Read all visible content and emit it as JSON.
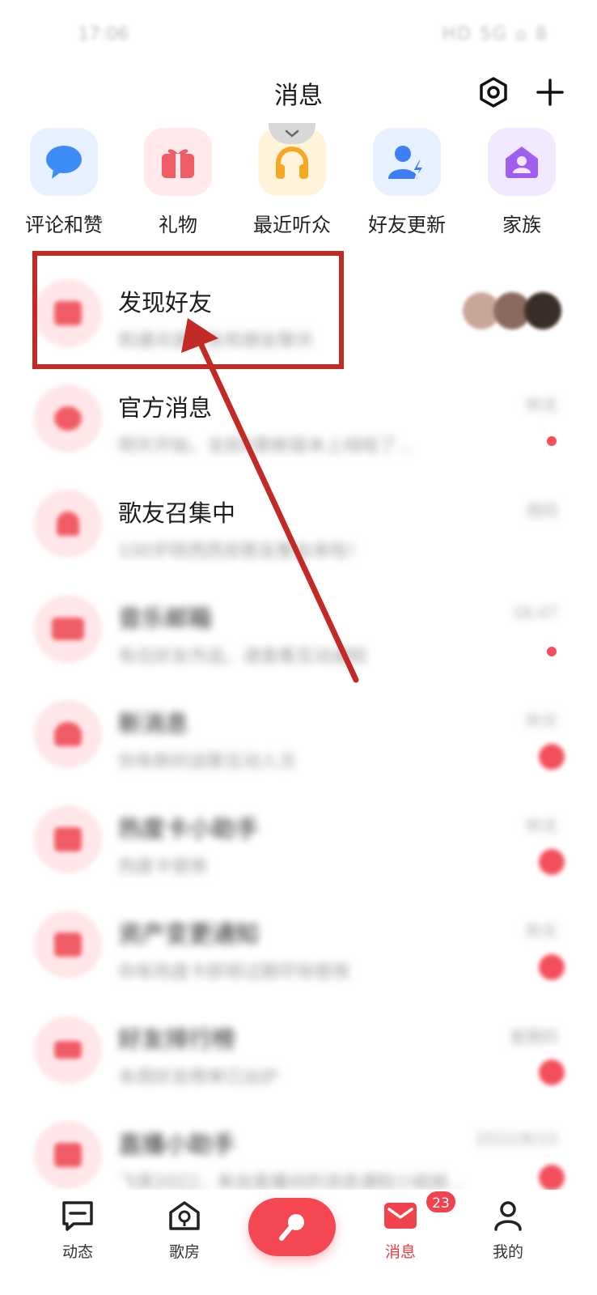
{
  "status_bar": {
    "time": "17:06",
    "icons": "HD 5G ⌂ 8"
  },
  "header": {
    "title": "消息",
    "settings_icon": "hexagon-settings-icon",
    "add_icon": "plus-icon"
  },
  "shortcuts": [
    {
      "label": "评论和赞",
      "icon": "chat-bubble-icon",
      "color": "#3d8cf5"
    },
    {
      "label": "礼物",
      "icon": "gift-icon",
      "color": "#f05c66"
    },
    {
      "label": "最近听众",
      "icon": "headphones-icon",
      "color": "#f7a823"
    },
    {
      "label": "好友更新",
      "icon": "user-lightning-icon",
      "color": "#3d7ef5"
    },
    {
      "label": "家族",
      "icon": "family-house-icon",
      "color": "#9f5ef0"
    }
  ],
  "messages": [
    {
      "title": "发现好友",
      "preview": "和通讯录好友和朋友聊天",
      "time": ""
    },
    {
      "title": "官方消息",
      "preview": "明天开始，全民K歌新版本上线啦了...",
      "time": "昨天"
    },
    {
      "title": "歌友召集中",
      "preview": "100岁陕西西安歌友聚会来啦！",
      "time": "周四"
    },
    {
      "title": "音乐邮箱",
      "preview": "有位好友作品，请查看互动通知",
      "time": "16:47"
    },
    {
      "title": "新消息",
      "preview": "你有新的送歌互动人次",
      "time": "昨天"
    },
    {
      "title": "热度卡小助手",
      "preview": "热度卡使用",
      "time": "昨天"
    },
    {
      "title": "资产变更通知",
      "preview": "你有热度卡即将过期尽快使用",
      "time": "昨天"
    },
    {
      "title": "好友排行榜",
      "preview": "本周好友榜单已出炉",
      "time": "星期四"
    },
    {
      "title": "直播小助手",
      "preview": "飞哥2022，来自直播间的消息通知小姐姐...",
      "time": "2022/8/15"
    }
  ],
  "bottom_nav": [
    {
      "label": "动态",
      "icon": "feed-icon"
    },
    {
      "label": "歌房",
      "icon": "ktv-room-icon"
    },
    {
      "label": "",
      "icon": "microphone-icon"
    },
    {
      "label": "消息",
      "icon": "mail-icon",
      "badge": "23",
      "active": true
    },
    {
      "label": "我的",
      "icon": "profile-icon"
    }
  ],
  "colors": {
    "accent": "#f05c66",
    "annotation": "#c22a25"
  }
}
